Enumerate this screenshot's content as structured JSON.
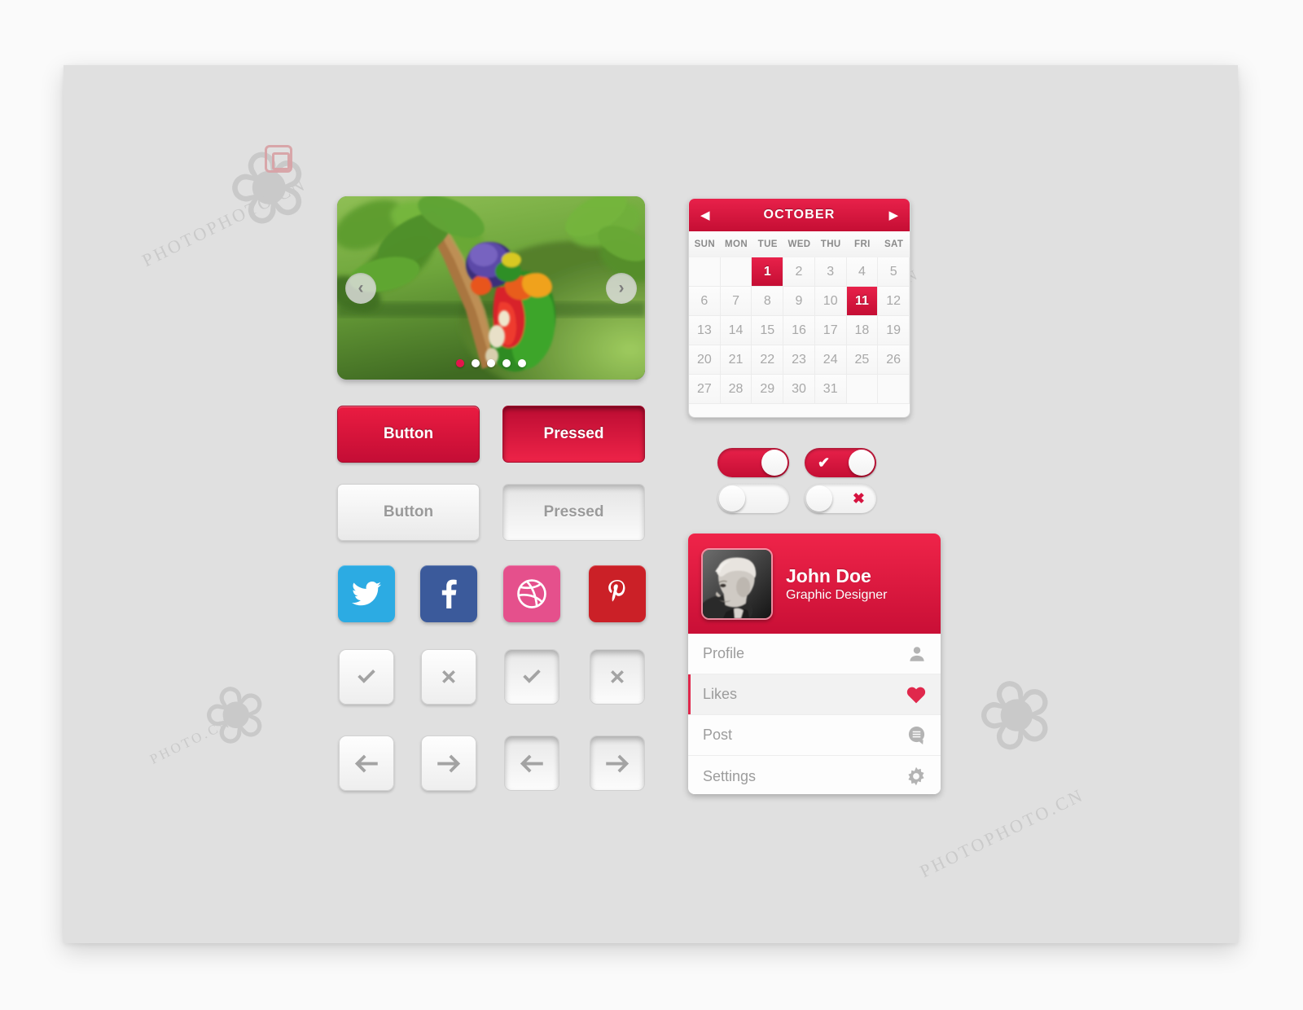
{
  "theme": {
    "accent": "#d6123b",
    "accent_light": "#ea1c41",
    "panel_bg": "#e0e0e0",
    "canvas_bg": "#fafafa"
  },
  "watermark": {
    "text_1": "PHOTOPHOTO.CN",
    "text_2": "PHOTO.CN",
    "text_3": "PHOTOPHOTO.CN"
  },
  "slider": {
    "prev_icon": "chevron-left-icon",
    "next_icon": "chevron-right-icon",
    "prev_glyph": "‹",
    "next_glyph": "›",
    "dots": [
      {
        "active": true
      },
      {
        "active": false
      },
      {
        "active": false
      },
      {
        "active": false
      },
      {
        "active": false
      }
    ],
    "image_alt": "rainbow lorikeet parrot on branch with green leaves"
  },
  "buttons": {
    "red_normal": "Button",
    "red_pressed": "Pressed",
    "white_normal": "Button",
    "white_pressed": "Pressed"
  },
  "social": [
    {
      "name": "twitter",
      "label": "Twitter",
      "color": "#2cabe3"
    },
    {
      "name": "facebook",
      "label": "Facebook",
      "color": "#3b5a9b"
    },
    {
      "name": "dribbble",
      "label": "Dribbble",
      "color": "#e5508c"
    },
    {
      "name": "pinterest",
      "label": "Pinterest",
      "color": "#cb2027"
    }
  ],
  "icon_buttons": [
    {
      "name": "check",
      "glyph": "check-icon",
      "state": "normal"
    },
    {
      "name": "close",
      "glyph": "close-icon",
      "state": "normal"
    },
    {
      "name": "check",
      "glyph": "check-icon",
      "state": "pressed"
    },
    {
      "name": "close",
      "glyph": "close-icon",
      "state": "pressed"
    },
    {
      "name": "arrow-left",
      "glyph": "arrow-left-icon",
      "state": "normal"
    },
    {
      "name": "arrow-right",
      "glyph": "arrow-right-icon",
      "state": "normal"
    },
    {
      "name": "arrow-left",
      "glyph": "arrow-left-icon",
      "state": "pressed"
    },
    {
      "name": "arrow-right",
      "glyph": "arrow-right-icon",
      "state": "pressed"
    }
  ],
  "calendar": {
    "month": "OCTOBER",
    "prev_glyph": "◀",
    "next_glyph": "▶",
    "weekdays": [
      "SUN",
      "MON",
      "TUE",
      "WED",
      "THU",
      "FRI",
      "SAT"
    ],
    "leading_blanks": 2,
    "days": [
      1,
      2,
      3,
      4,
      5,
      6,
      7,
      8,
      9,
      10,
      11,
      12,
      13,
      14,
      15,
      16,
      17,
      18,
      19,
      20,
      21,
      22,
      23,
      24,
      25,
      26,
      27,
      28,
      29,
      30,
      31
    ],
    "selected": [
      1,
      11
    ],
    "trailing_blanks": 2
  },
  "toggles": [
    {
      "name": "toggle-on-plain",
      "state": "on",
      "mark": ""
    },
    {
      "name": "toggle-on-check",
      "state": "on",
      "mark": "check",
      "glyph": "✔"
    },
    {
      "name": "toggle-off-plain",
      "state": "off",
      "mark": ""
    },
    {
      "name": "toggle-off-cross",
      "state": "off",
      "mark": "cross",
      "glyph": "✖"
    }
  ],
  "profile": {
    "name": "John Doe",
    "role": "Graphic Designer",
    "avatar_alt": "black and white portrait of a young man",
    "menu": [
      {
        "label": "Profile",
        "icon": "user-icon",
        "active": false
      },
      {
        "label": "Likes",
        "icon": "heart-icon",
        "active": true
      },
      {
        "label": "Post",
        "icon": "comment-icon",
        "active": false
      },
      {
        "label": "Settings",
        "icon": "gear-icon",
        "active": false
      }
    ]
  }
}
